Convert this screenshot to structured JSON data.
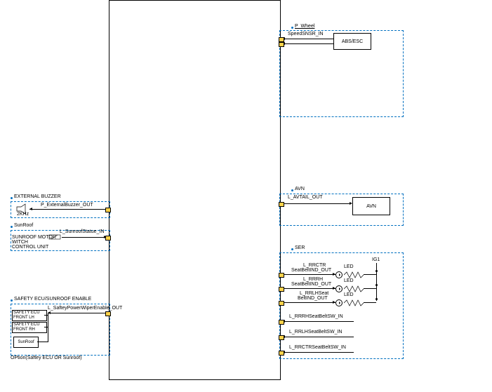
{
  "left": {
    "external_buzzer": {
      "header": "EXTERNAL BUZZER",
      "signal": "P_ExternalBuzzer_OUT",
      "freq": "2KHz"
    },
    "sunroof": {
      "header": "SunRoof",
      "unit_l1": "SUNROOF MOTOR",
      "unit_l2": "WITCH",
      "unit_l3": "CONTROL UNIT",
      "signal": "L_SunroofStatue_IN"
    },
    "safety": {
      "header": "SAFETY ECU/SUNROOF ENABLE",
      "box1_l1": "SAFETY ECU",
      "box1_l2": "FRONT LH",
      "box2_l1": "SAFETY ECU",
      "box2_l2": "FRONT RH",
      "box3": "SunRoof",
      "signal": "L_SafteyPowerWiperEnable_OUT",
      "note": "OPtion(Saftey ECU OR Sunroof)"
    }
  },
  "right": {
    "pwheel": {
      "header": "P_Wheel",
      "signal": "SpeedSNSR_IN",
      "box": "ABS/ESC"
    },
    "avn": {
      "header": "AVN",
      "signal": "L_AVTAIL_OUT",
      "box": "AVN"
    },
    "ser": {
      "header": "SER",
      "ig1": "IG1",
      "led": "LED",
      "s1a": "L_RRCTR",
      "s1b": "SeatBeltIND_OUT",
      "s2a": "L_RRRH",
      "s2b": "SeatBeltIND_OUT",
      "s3a": "L_RRLHSeat",
      "s3b": "BeltIND_OUT",
      "s4": "L_RRRHSeatBeltSW_IN",
      "s5": "L_RRLHSeatBeltSW_IN",
      "s6": "L_RRCTRSeatBeltSW_IN"
    }
  }
}
